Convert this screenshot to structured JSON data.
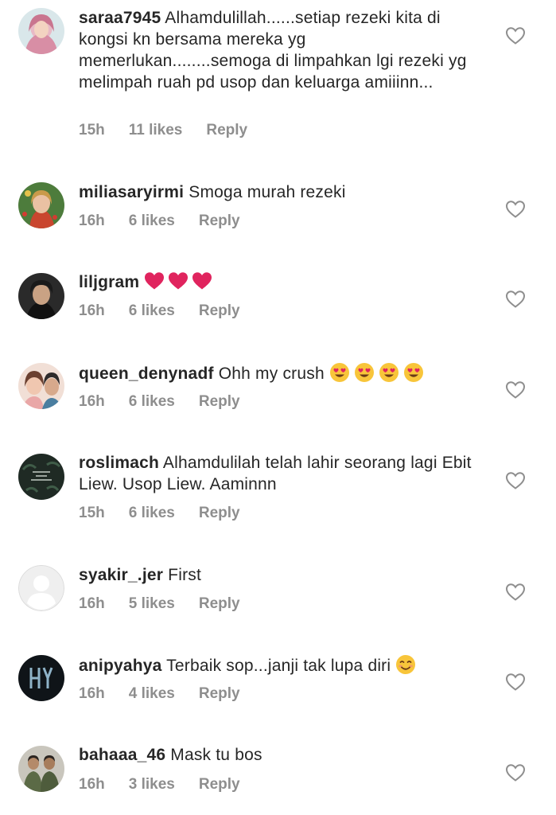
{
  "comments": [
    {
      "username": "saraa7945",
      "text": "Alhamdulillah......setiap rezeki kita di kongsi kn bersama mereka yg memerlukan........semoga di limpahkan lgi rezeki yg melimpah ruah pd usop dan keluarga amiiinn...",
      "time": "15h",
      "likes": "11 likes",
      "reply": "Reply",
      "emojis": []
    },
    {
      "username": "miliasaryirmi",
      "text": "Smoga murah rezeki",
      "time": "16h",
      "likes": "6 likes",
      "reply": "Reply",
      "emojis": []
    },
    {
      "username": "liljgram",
      "text": "",
      "time": "16h",
      "likes": "6 likes",
      "reply": "Reply",
      "emojis": [
        "red-heart",
        "red-heart",
        "red-heart"
      ]
    },
    {
      "username": "queen_denynadf",
      "text": "Ohh my crush",
      "time": "16h",
      "likes": "6 likes",
      "reply": "Reply",
      "emojis": [
        "heart-eyes",
        "heart-eyes",
        "heart-eyes",
        "heart-eyes"
      ]
    },
    {
      "username": "roslimach",
      "text": "Alhamdulilah telah lahir seorang lagi Ebit Liew. Usop Liew. Aaminnn",
      "time": "15h",
      "likes": "6 likes",
      "reply": "Reply",
      "emojis": []
    },
    {
      "username": "syakir_.jer",
      "text": "First",
      "time": "16h",
      "likes": "5 likes",
      "reply": "Reply",
      "emojis": []
    },
    {
      "username": "anipyahya",
      "text": "Terbaik sop...janji tak lupa diri",
      "time": "16h",
      "likes": "4 likes",
      "reply": "Reply",
      "emojis": [
        "smiling-face"
      ]
    },
    {
      "username": "bahaaa_46",
      "text": "Mask tu bos",
      "time": "16h",
      "likes": "3 likes",
      "reply": "Reply",
      "emojis": []
    }
  ],
  "colors": {
    "text": "#262626",
    "meta": "#8e8e8e",
    "heart_outline": "#8e8e8e",
    "emoji_red": "#e0245e"
  },
  "icons": {
    "like": "heart-outline-icon",
    "avatar_placeholder": "default-avatar-icon"
  }
}
